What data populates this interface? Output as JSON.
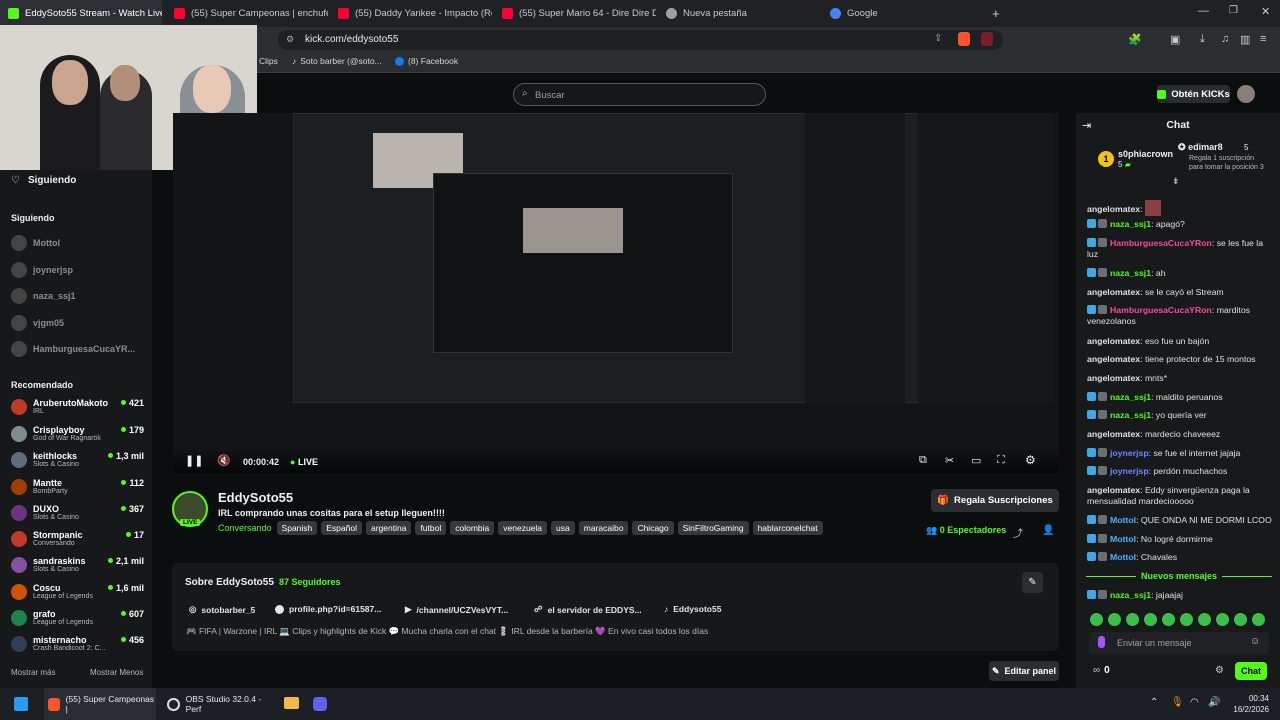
{
  "browser": {
    "tabs": [
      {
        "label": "EddySoto55 Stream - Watch Live",
        "color": "#53fc18"
      },
      {
        "label": "(55) Super Campeonas | enchufetv -",
        "color": "#ff0033"
      },
      {
        "label": "(55) Daddy Yankee - Impacto (Remix)",
        "color": "#ff0033"
      },
      {
        "label": "(55) Super Mario 64 - Dire Dire Dock",
        "color": "#ff0033"
      },
      {
        "label": "Nueva pestaña",
        "color": "#9aa0a6"
      },
      {
        "label": "Google",
        "color": "#4285f4"
      }
    ],
    "url": "kick.com/eddysoto55",
    "bookmarks": [
      "Clips",
      "Soto barber (@soto...",
      "(8) Facebook"
    ]
  },
  "header": {
    "search_placeholder": "Buscar",
    "get_kicks": "Obtén KICKs"
  },
  "sidebar": {
    "title": "Siguiendo",
    "following_title": "Siguiendo",
    "following": [
      "Mottol",
      "joynerjsp",
      "naza_ssj1",
      "vjgm05",
      "HamburguesaCucaYR..."
    ],
    "recommended_title": "Recomendado",
    "recommended": [
      {
        "name": "AruberutoMakoto",
        "cat": "IRL",
        "count": "421"
      },
      {
        "name": "Crisplayboy",
        "cat": "God of War Ragnarök",
        "count": "179"
      },
      {
        "name": "keithlocks",
        "cat": "Slots & Casino",
        "count": "1,3 mil"
      },
      {
        "name": "Mantte",
        "cat": "BombParty",
        "count": "112"
      },
      {
        "name": "DUXO",
        "cat": "Slots & Casino",
        "count": "367"
      },
      {
        "name": "Stormpanic",
        "cat": "Conversando",
        "count": "17"
      },
      {
        "name": "sandraskins",
        "cat": "Slots & Casino",
        "count": "2,1 mil"
      },
      {
        "name": "Coscu",
        "cat": "League of Legends",
        "count": "1,6 mil"
      },
      {
        "name": "grafo",
        "cat": "League of Legends",
        "count": "607"
      },
      {
        "name": "misternacho",
        "cat": "Crash Bandicoot 2: C...",
        "count": "456"
      }
    ],
    "show_more": "Mostrar más",
    "show_less": "Mostrar Menos"
  },
  "player": {
    "time": "00:00:42",
    "live": "LIVE"
  },
  "stream": {
    "name": "EddySoto55",
    "title": "IRL comprando unas cositas para el setup lleguen!!!!",
    "category": "Conversando",
    "tags": [
      "Spanish",
      "Español",
      "argentina",
      "futbol",
      "colombia",
      "venezuela",
      "usa",
      "maracaibo",
      "Chicago",
      "SinFiltroGaming",
      "hablarconelchat"
    ],
    "live_badge": "LIVE",
    "gift_subs": "Regala Suscripciones",
    "viewers": "0 Espectadores"
  },
  "about": {
    "title": "Sobre EddySoto55",
    "followers": "87 Seguidores",
    "links": [
      "sotobarber_5",
      "profile.php?id=61587...",
      "/channel/UCZVesVYT...",
      "el servidor de EDDYS...",
      "Eddysoto55"
    ],
    "bio": "🎮 FIFA | Warzone | IRL 💻 Clips y highlights de Kick 💬 Mucha charla con el chat 💈 IRL desde la barbería 💜 En vivo casi todos los días",
    "edit_panel": "Editar panel"
  },
  "chat": {
    "title": "Chat",
    "top_gifter": "s0phiacrown",
    "top_gifter_count": "5",
    "gifter2": "edimar8",
    "gifter2_count": "5",
    "gift_cta": "Regala 1 suscripción para tomar la posición 3",
    "messages": [
      {
        "user": "angelomatex",
        "text": "",
        "color": "#eef0f1",
        "badge": false
      },
      {
        "user": "naza_ssj1",
        "text": "apagó?",
        "color": "#53fc18",
        "badge": true
      },
      {
        "user": "HamburguesaCucaYRon",
        "text": "se les fue la luz",
        "color": "#f54da0",
        "badge": true
      },
      {
        "user": "naza_ssj1",
        "text": "ah",
        "color": "#53fc18",
        "badge": true
      },
      {
        "user": "angelomatex",
        "text": "se le cayó el Stream",
        "color": "#eef0f1",
        "badge": false
      },
      {
        "user": "HamburguesaCucaYRon",
        "text": "marditos venezolanos",
        "color": "#f54da0",
        "badge": true
      },
      {
        "user": "angelomatex",
        "text": "eso fue un bajón",
        "color": "#eef0f1",
        "badge": false
      },
      {
        "user": "angelomatex",
        "text": "tiene protector de 15 montos",
        "color": "#eef0f1",
        "badge": false
      },
      {
        "user": "angelomatex",
        "text": "mnts*",
        "color": "#eef0f1",
        "badge": false
      },
      {
        "user": "naza_ssj1",
        "text": "maldito peruanos",
        "color": "#53fc18",
        "badge": true
      },
      {
        "user": "naza_ssj1",
        "text": "yo quería ver",
        "color": "#53fc18",
        "badge": true
      },
      {
        "user": "angelomatex",
        "text": "mardecio chaveeez",
        "color": "#eef0f1",
        "badge": false
      },
      {
        "user": "joynerjsp",
        "text": "se fue el internet jajaja",
        "color": "#6a8cff",
        "badge": true
      },
      {
        "user": "joynerjsp",
        "text": "perdón muchachos",
        "color": "#6a8cff",
        "badge": true
      },
      {
        "user": "angelomatex",
        "text": "Eddy sinvergüenza paga la mensualidad mardeciooooo",
        "color": "#eef0f1",
        "badge": false
      },
      {
        "user": "Mottol",
        "text": "QUE ONDA NI ME DORMI LCOO",
        "color": "#4db3ff",
        "badge": true
      },
      {
        "user": "Mottol",
        "text": "No logré dormirme",
        "color": "#4db3ff",
        "badge": true
      },
      {
        "user": "Mottol",
        "text": "Chavales",
        "color": "#4db3ff",
        "badge": true
      }
    ],
    "new_messages": "Nuevos mensajes",
    "last": {
      "user": "naza_ssj1",
      "text": "jajaajaj"
    },
    "input_placeholder": "Enviar un mensaje",
    "points": "0",
    "send": "Chat"
  },
  "taskbar": {
    "items": [
      "(55) Super Campeonas |",
      "OBS Studio 32.0.4 - Perf"
    ],
    "time": "00:34",
    "date": "16/2/2026"
  },
  "colors": {
    "accent": "#53fc18",
    "bg": "#0b0e0f",
    "panel": "#17191b"
  }
}
